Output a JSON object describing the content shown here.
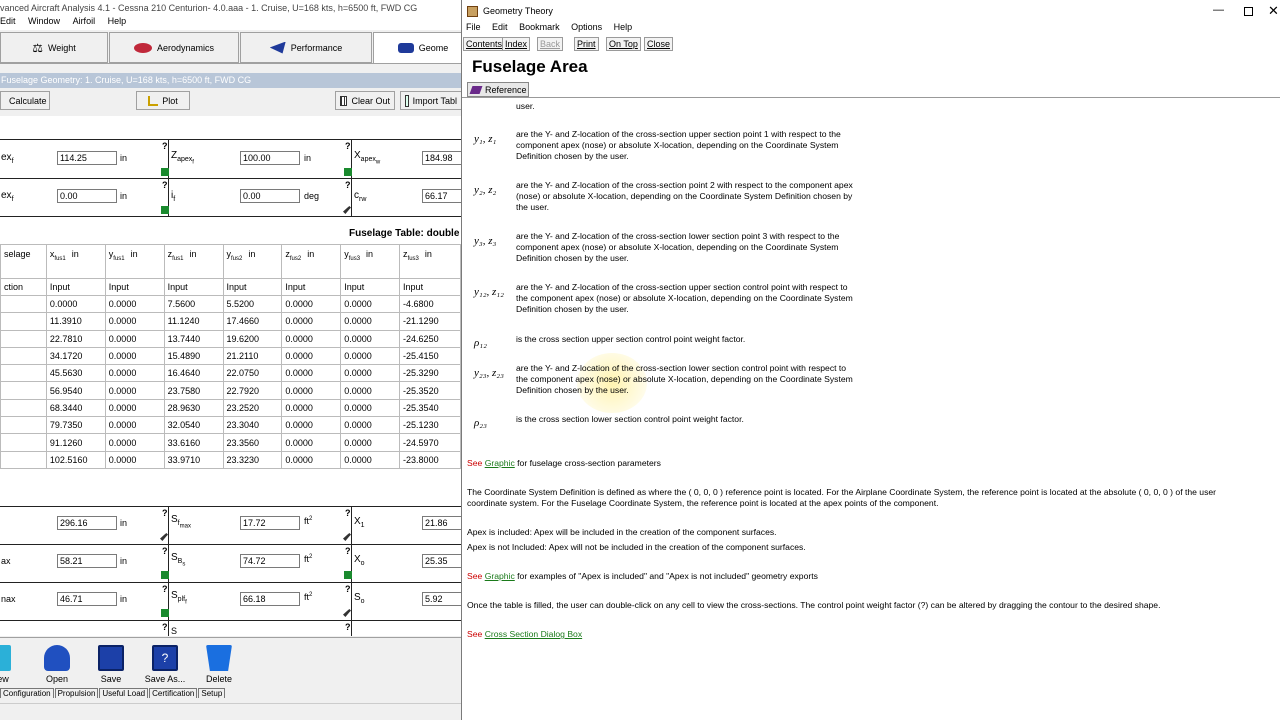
{
  "left": {
    "title": "vanced Aircraft Analysis 4.1 - Cessna 210 Centurion- 4.0.aaa - 1. Cruise, U=168 kts, h=6500 ft, FWD CG",
    "menu": [
      "Edit",
      "Window",
      "Airfoil",
      "Help"
    ],
    "modules": [
      "Weight",
      "Aerodynamics",
      "Performance",
      "Geome"
    ],
    "subtitle": "Fuselage Geometry: 1. Cruise, U=168 kts, h=6500 ft, FWD CG",
    "toolbar": {
      "calculate": "Calculate",
      "plot": "Plot",
      "clear_out": "Clear Out",
      "import_table": "Import Tabl"
    },
    "params": {
      "r1c1_label": "ex",
      "r1c1_sub": "f",
      "r1c1_value": "114.25",
      "r1c1_unit": "in",
      "r1c2_label": "Z",
      "r1c2_sub": "apex",
      "r1c2_sub2": "f",
      "r1c2_value": "100.00",
      "r1c2_unit": "in",
      "r1c3_label": "X",
      "r1c3_sub": "apex",
      "r1c3_sub2": "w",
      "r1c3_value": "184.98",
      "r2c1_label": "ex",
      "r2c1_sub": "f",
      "r2c1_value": "0.00",
      "r2c1_unit": "in",
      "r2c2_label": "i",
      "r2c2_sub": "f",
      "r2c2_value": "0.00",
      "r2c2_unit": "deg",
      "r2c3_label": "c",
      "r2c3_sub": "rw",
      "r2c3_value": "66.17"
    },
    "table_title": "Fuselage Table: double c",
    "table_headers": [
      "selage",
      "x",
      "y",
      "z",
      "y",
      "z",
      "y",
      "z"
    ],
    "table_header_subs": [
      "",
      "fus1",
      "fus1",
      "fus1",
      "fus2",
      "fus2",
      "fus3",
      "fus3"
    ],
    "table_unit": "in",
    "table_second_header": [
      "ction",
      "Input",
      "Input",
      "Input",
      "Input",
      "Input",
      "Input",
      "Input"
    ],
    "table_rows": [
      [
        "",
        "0.0000",
        "0.0000",
        "7.5600",
        "5.5200",
        "0.0000",
        "0.0000",
        "-4.6800"
      ],
      [
        "",
        "11.3910",
        "0.0000",
        "11.1240",
        "17.4660",
        "0.0000",
        "0.0000",
        "-21.1290"
      ],
      [
        "",
        "22.7810",
        "0.0000",
        "13.7440",
        "19.6200",
        "0.0000",
        "0.0000",
        "-24.6250"
      ],
      [
        "",
        "34.1720",
        "0.0000",
        "15.4890",
        "21.2110",
        "0.0000",
        "0.0000",
        "-25.4150"
      ],
      [
        "",
        "45.5630",
        "0.0000",
        "16.4640",
        "22.0750",
        "0.0000",
        "0.0000",
        "-25.3290"
      ],
      [
        "",
        "56.9540",
        "0.0000",
        "23.7580",
        "22.7920",
        "0.0000",
        "0.0000",
        "-25.3520"
      ],
      [
        "",
        "68.3440",
        "0.0000",
        "28.9630",
        "23.2520",
        "0.0000",
        "0.0000",
        "-25.3540"
      ],
      [
        "",
        "79.7350",
        "0.0000",
        "32.0540",
        "23.3040",
        "0.0000",
        "0.0000",
        "-25.1230"
      ],
      [
        "",
        "91.1260",
        "0.0000",
        "33.6160",
        "23.3560",
        "0.0000",
        "0.0000",
        "-24.5970"
      ],
      [
        "",
        "102.5160",
        "0.0000",
        "33.9710",
        "23.3230",
        "0.0000",
        "0.0000",
        "-23.8000"
      ]
    ],
    "results": {
      "r1_value": "296.16",
      "r1_unit": "in",
      "r1_label2": "S",
      "r1_sub2": "f",
      "r1_sub2b": "max",
      "r1_value2": "17.72",
      "r1_unit2": "ft",
      "r1_label3": "X",
      "r1_sub3": "1",
      "r1_value3": "21.86",
      "r2_label": "ax",
      "r2_value": "58.21",
      "r2_unit": "in",
      "r2_label2": "S",
      "r2_sub2": "B",
      "r2_sub2b": "s",
      "r2_value2": "74.72",
      "r2_unit2": "ft",
      "r2_label3": "X",
      "r2_sub3": "o",
      "r2_value3": "25.35",
      "r3_label": "nax",
      "r3_value": "46.71",
      "r3_unit": "in",
      "r3_label2": "S",
      "r3_sub2": "plf",
      "r3_sub2b": "f",
      "r3_value2": "66.18",
      "r3_unit2": "ft",
      "r3_label3": "S",
      "r3_sub3": "o",
      "r3_value3": "5.92",
      "r4_label2": "S"
    },
    "bottom_buttons": [
      "ew",
      "Open",
      "Save",
      "Save As...",
      "Delete"
    ],
    "bottom_tabs": [
      "Configuration",
      "Propulsion",
      "Useful Load",
      "Certification",
      "Setup"
    ]
  },
  "help": {
    "window_title": "Geometry Theory",
    "menu": [
      "File",
      "Edit",
      "Bookmark",
      "Options",
      "Help"
    ],
    "buttons": [
      "Contents",
      "Index",
      "Back",
      "Print",
      "On Top",
      "Close"
    ],
    "heading": "Fuselage Area",
    "reference_label": "Reference",
    "cut_line": "user.",
    "entries": [
      {
        "sym": "y₁, z₁",
        "text": "are the Y- and Z-location of the cross-section upper section point 1 with respect to the component apex (nose) or absolute X-location, depending on the Coordinate System Definition chosen by the user."
      },
      {
        "sym": "y₂, z₂",
        "text": "are the Y- and Z-location of the cross-section point 2 with respect to the component apex (nose) or absolute X-location, depending on the Coordinate System Definition chosen by the user."
      },
      {
        "sym": "y₃, z₃",
        "text": "are the Y- and Z-location of the cross-section lower section point 3 with respect to the component apex (nose) or absolute X-location, depending on the Coordinate System Definition chosen by the user."
      },
      {
        "sym": "y₁₂, z₁₂",
        "text": "are the Y- and Z-location of the cross-section upper section control point with respect to the component apex (nose) or absolute X-location, depending on the Coordinate System Definition chosen by the user."
      },
      {
        "sym": "ρ₁₂",
        "text": "is the cross section upper section control point weight factor."
      },
      {
        "sym": "y₂₃, z₂₃",
        "text": "are the Y- and Z-location of the cross-section lower section control point with respect to the component apex (nose) or absolute X-location, depending on the Coordinate System Definition chosen by the user."
      },
      {
        "sym": "ρ₂₃",
        "text": "is the cross section lower section control point weight factor."
      }
    ],
    "see1_prefix": "See",
    "see1_link": "Graphic",
    "see1_rest": "for fuselage cross-section parameters",
    "coord_line1": "The Coordinate System Definition is defined as where the ( 0, 0, 0 ) reference point is located.  For the Airplane Coordinate System, the reference point is located at the absolute ( 0, 0, 0 ) of the user",
    "coord_line2": "coordinate system.  For the Fuselage Coordinate System, the reference point is located at the apex points of the component.",
    "apex_included": "Apex is included: Apex will be included in the creation of the component surfaces.",
    "apex_not_included": "Apex is not Included: Apex will not be included in the creation of the component surfaces.",
    "see2_prefix": "See",
    "see2_link": "Graphic",
    "see2_rest": "for examples of \"Apex is included\" and \"Apex is not included\" geometry exports",
    "table_note": "Once the table is filled, the user can double-click on any cell to view the cross-sections.  The control point weight factor (?) can be altered by dragging the contour to the desired shape.",
    "see3_prefix": "See",
    "see3_link": "Cross Section Dialog Box"
  },
  "colors": {
    "link": "#1a7a1a",
    "see": "#cc0000",
    "subtitle_bar": "#b8c6d8"
  },
  "icons": [
    "scale-icon",
    "aero-icon",
    "performance-icon",
    "geometry-icon",
    "calculator-icon",
    "plot-icon",
    "clear-out-icon",
    "import-table-icon",
    "open-icon",
    "save-icon",
    "save-as-icon",
    "delete-icon",
    "help-book-icon",
    "reference-book-icon"
  ]
}
